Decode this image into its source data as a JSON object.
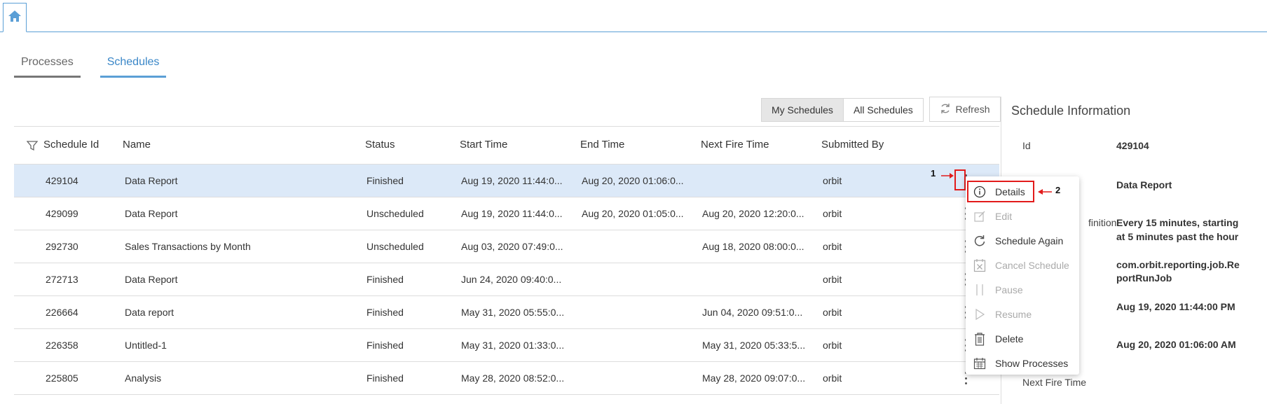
{
  "home_icon": "home-icon",
  "tabs": [
    {
      "label": "Processes",
      "active": false
    },
    {
      "label": "Schedules",
      "active": true
    }
  ],
  "toggle": {
    "my": "My Schedules",
    "all": "All Schedules"
  },
  "refresh_label": "Refresh",
  "table": {
    "headers": [
      "Schedule Id",
      "Name",
      "Status",
      "Start Time",
      "End Time",
      "Next Fire Time",
      "Submitted By"
    ],
    "rows": [
      {
        "id": "429104",
        "name": "Data Report",
        "status": "Finished",
        "start": "Aug 19, 2020 11:44:0...",
        "end": "Aug 20, 2020 01:06:0...",
        "next": "",
        "by": "orbit",
        "selected": true
      },
      {
        "id": "429099",
        "name": "Data Report",
        "status": "Unscheduled",
        "start": "Aug 19, 2020 11:44:0...",
        "end": "Aug 20, 2020 01:05:0...",
        "next": "Aug 20, 2020 12:20:0...",
        "by": "orbit"
      },
      {
        "id": "292730",
        "name": "Sales Transactions by Month",
        "status": "Unscheduled",
        "start": "Aug 03, 2020 07:49:0...",
        "end": "",
        "next": "Aug 18, 2020 08:00:0...",
        "by": "orbit"
      },
      {
        "id": "272713",
        "name": "Data Report",
        "status": "Finished",
        "start": "Jun 24, 2020 09:40:0...",
        "end": "",
        "next": "",
        "by": "orbit"
      },
      {
        "id": "226664",
        "name": "Data report",
        "status": "Finished",
        "start": "May 31, 2020 05:55:0...",
        "end": "",
        "next": "Jun 04, 2020 09:51:0...",
        "by": "orbit"
      },
      {
        "id": "226358",
        "name": "Untitled-1",
        "status": "Finished",
        "start": "May 31, 2020 01:33:0...",
        "end": "",
        "next": "May 31, 2020 05:33:5...",
        "by": "orbit"
      },
      {
        "id": "225805",
        "name": "Analysis",
        "status": "Finished",
        "start": "May 28, 2020 08:52:0...",
        "end": "",
        "next": "May 28, 2020 09:07:0...",
        "by": "orbit"
      }
    ]
  },
  "menu": {
    "details": "Details",
    "edit": "Edit",
    "schedule_again": "Schedule Again",
    "cancel_schedule": "Cancel Schedule",
    "pause": "Pause",
    "resume": "Resume",
    "delete": "Delete",
    "show_processes": "Show Processes"
  },
  "panel": {
    "title": "Schedule Information",
    "id_label": "Id",
    "id_value": "429104",
    "name_value": "Data Report",
    "definition_label_partial": "finition",
    "definition_line1": "Every 15 minutes, starting",
    "definition_line2": "at 5 minutes past the hour",
    "job_line1": "com.orbit.reporting.job.Re",
    "job_line2": "portRunJob",
    "start_value": "Aug 19, 2020 11:44:00 PM",
    "end_value": "Aug 20, 2020 01:06:00 AM",
    "next_fire_label": "Next Fire Time"
  },
  "annotations": {
    "one": "1",
    "two": "2"
  },
  "colors": {
    "accent": "#5b9fd6",
    "highlight_row": "#dce9f8",
    "annotation_red": "#e21b1b"
  }
}
